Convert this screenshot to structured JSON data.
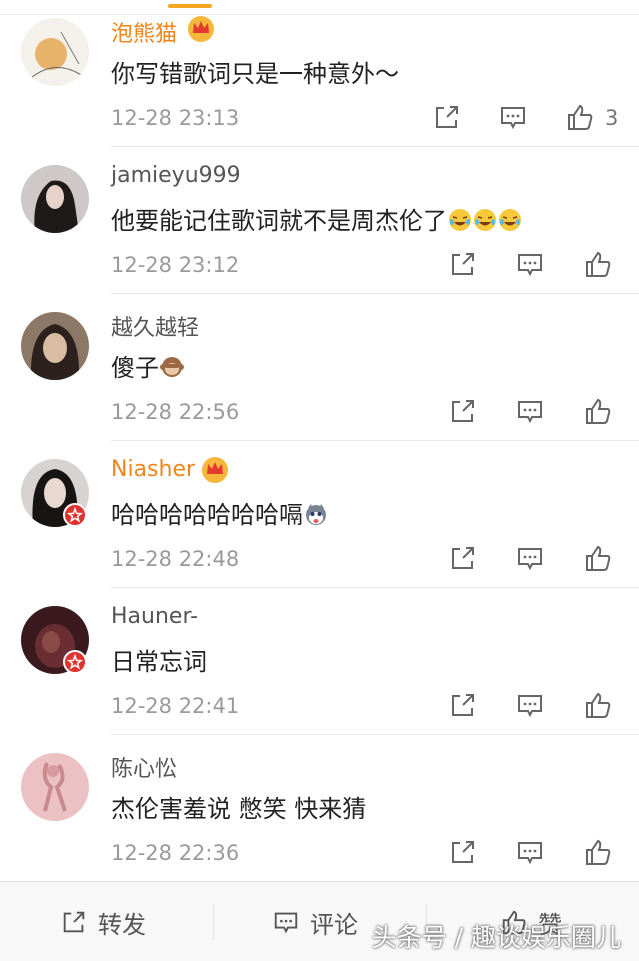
{
  "comments": [
    {
      "user": "泡熊猫",
      "vip": true,
      "text": "你写错歌词只是一种意外～",
      "emojis": [],
      "time": "12-28 23:13",
      "likes": "3",
      "verified": false
    },
    {
      "user": "jamieyu999",
      "vip": false,
      "text": "他要能记住歌词就不是周杰伦了",
      "emojis": [
        "laugh-cry",
        "laugh-cry",
        "laugh-cry"
      ],
      "time": "12-28 23:12",
      "likes": "",
      "verified": false
    },
    {
      "user": "越久越轻",
      "vip": false,
      "text": "傻子",
      "emojis": [
        "monkey"
      ],
      "time": "12-28 22:56",
      "likes": "",
      "verified": false
    },
    {
      "user": "Niasher",
      "vip": true,
      "text": "哈哈哈哈哈哈哈嗝",
      "emojis": [
        "husky"
      ],
      "time": "12-28 22:48",
      "likes": "",
      "verified": true
    },
    {
      "user": "Hauner-",
      "vip": false,
      "text": "日常忘词",
      "emojis": [],
      "time": "12-28 22:41",
      "likes": "",
      "verified": true
    },
    {
      "user": "陈心忪",
      "vip": false,
      "text": "杰伦害羞说 憋笑 快来猜",
      "emojis": [],
      "time": "12-28 22:36",
      "likes": "",
      "verified": false
    }
  ],
  "bottom_bar": {
    "repost": "转发",
    "comment": "评论",
    "like": "赞"
  },
  "watermark": "头条号 / 趣谈娱乐圈儿",
  "colors": {
    "vip_name": "#f08519",
    "badge": "#e0322f",
    "accent": "#f5a623"
  }
}
